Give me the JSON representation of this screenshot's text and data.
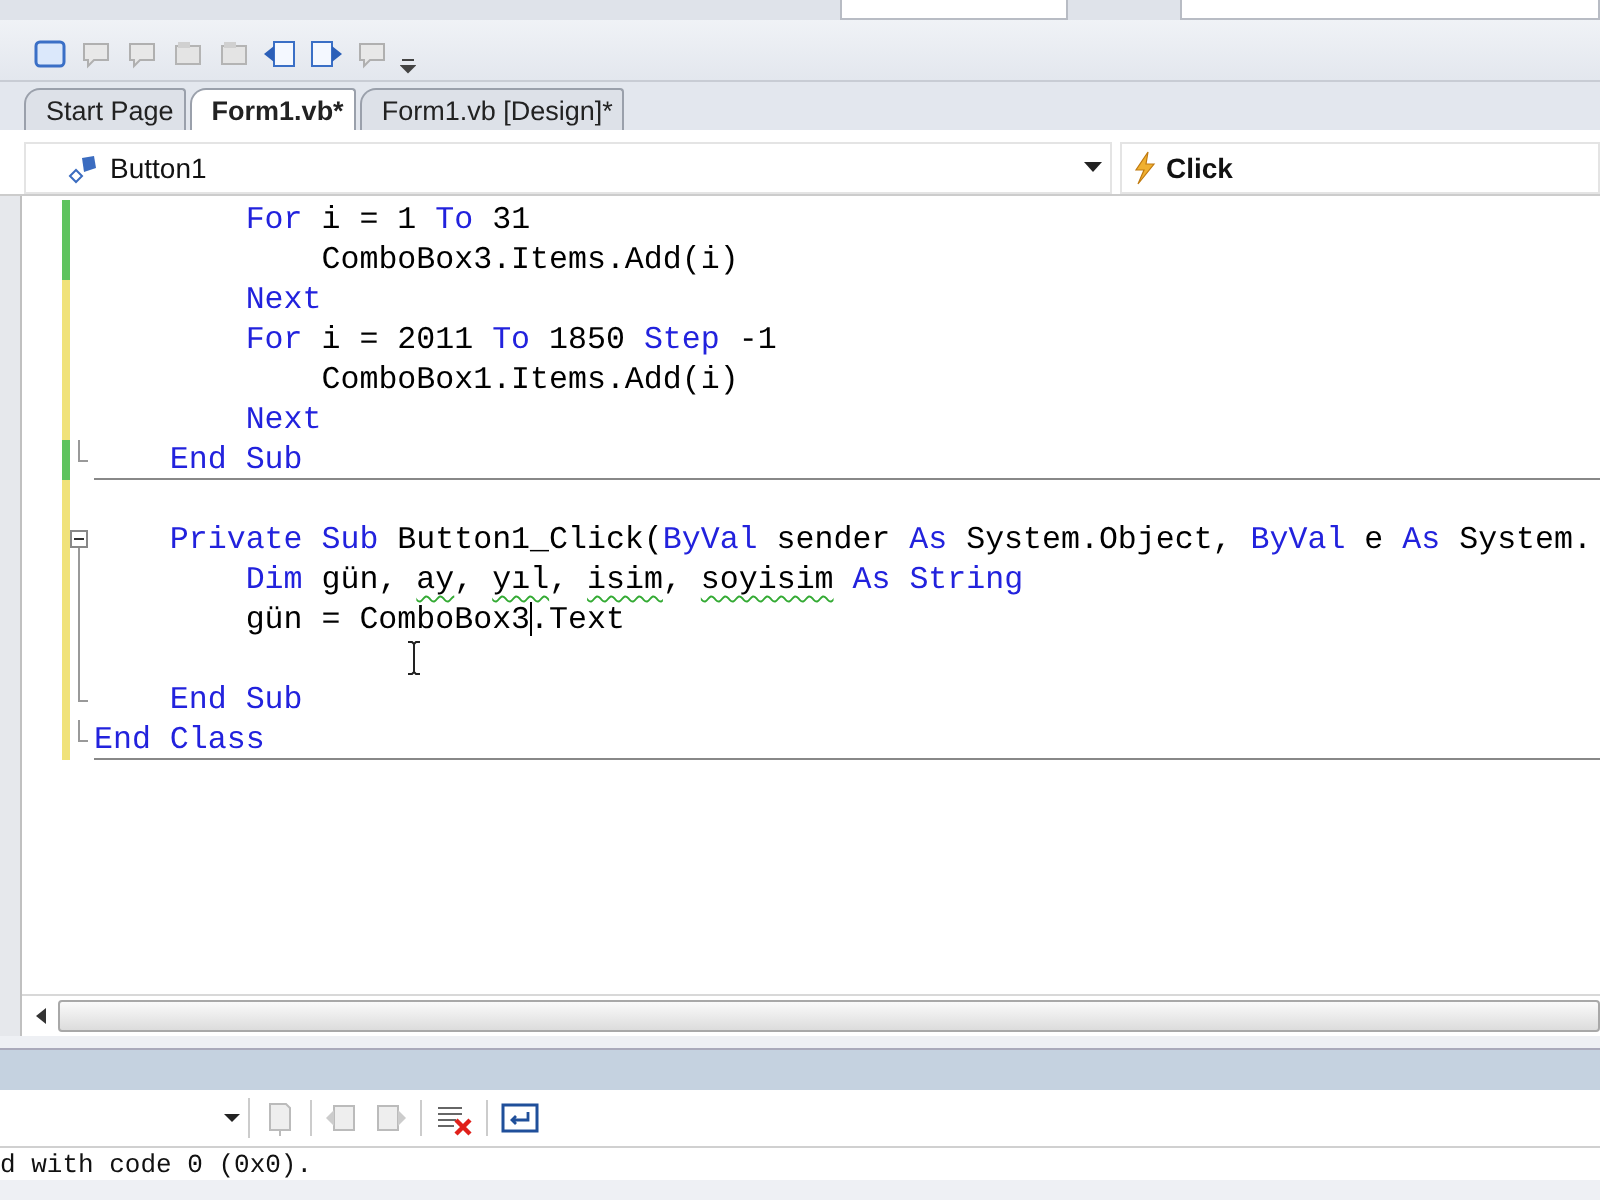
{
  "toolbar": {
    "buttons": [
      {
        "kind": "window"
      },
      {
        "kind": "comment"
      },
      {
        "kind": "comment"
      },
      {
        "kind": "bookmark"
      },
      {
        "kind": "bookmark"
      },
      {
        "kind": "prev"
      },
      {
        "kind": "next"
      },
      {
        "kind": "comment"
      }
    ]
  },
  "tabs": [
    {
      "label": "Start Page",
      "selected": false
    },
    {
      "label": "Form1.vb*",
      "selected": true
    },
    {
      "label": "Form1.vb [Design]*",
      "selected": false
    }
  ],
  "navigation": {
    "object": "Button1",
    "event": "Click"
  },
  "editor": {
    "lines": [
      {
        "saved": true,
        "kind": "statement",
        "tokens": [
          {
            "t": "For",
            "kind": "keyword"
          },
          {
            "t": " i = 1 "
          },
          {
            "t": "To",
            "kind": "keyword"
          },
          {
            "t": " 31"
          }
        ]
      },
      {
        "saved": true,
        "kind": "body",
        "tokens": [
          {
            "t": "ComboBox3.Items.Add(i)"
          }
        ]
      },
      {
        "saved": false,
        "kind": "statement",
        "tokens": [
          {
            "t": "Next",
            "kind": "keyword"
          }
        ]
      },
      {
        "saved": false,
        "kind": "statement",
        "tokens": [
          {
            "t": "For",
            "kind": "keyword"
          },
          {
            "t": " i = 2011 "
          },
          {
            "t": "To",
            "kind": "keyword"
          },
          {
            "t": " 1850 "
          },
          {
            "t": "Step",
            "kind": "keyword"
          },
          {
            "t": " -1"
          }
        ]
      },
      {
        "saved": false,
        "kind": "body",
        "tokens": [
          {
            "t": "ComboBox1.Items.Add(i)"
          }
        ]
      },
      {
        "saved": false,
        "kind": "statement",
        "tokens": [
          {
            "t": "Next",
            "kind": "keyword"
          }
        ]
      },
      {
        "saved": true,
        "kind": "member",
        "fold_end": true,
        "separator": true,
        "tokens": [
          {
            "t": "End Sub",
            "kind": "keyword"
          }
        ]
      },
      {
        "saved": false
      },
      {
        "saved": false,
        "kind": "member",
        "fold_start": true,
        "tokens": [
          {
            "t": "Private Sub",
            "kind": "keyword"
          },
          {
            "t": " Button1_Click("
          },
          {
            "t": "ByVal",
            "kind": "keyword"
          },
          {
            "t": " sender "
          },
          {
            "t": "As",
            "kind": "keyword"
          },
          {
            "t": " System.Object, "
          },
          {
            "t": "ByVal",
            "kind": "keyword"
          },
          {
            "t": " e "
          },
          {
            "t": "As",
            "kind": "keyword"
          },
          {
            "t": " System."
          }
        ]
      },
      {
        "saved": false,
        "kind": "statement",
        "in_fold": true,
        "tokens": [
          {
            "t": "Dim",
            "kind": "keyword"
          },
          {
            "t": " gün, "
          },
          {
            "t": "ay",
            "kind": "warning"
          },
          {
            "t": ", "
          },
          {
            "t": "yıl",
            "kind": "warning"
          },
          {
            "t": ", "
          },
          {
            "t": "isim",
            "kind": "warning"
          },
          {
            "t": ", "
          },
          {
            "t": "soyisim",
            "kind": "warning"
          },
          {
            "t": " As String",
            "kind": "keyword"
          }
        ]
      },
      {
        "saved": false,
        "kind": "statement",
        "in_fold": true,
        "tokens": [
          {
            "t": "gün = ComboBox3"
          },
          {
            "t": ".Text",
            "caret_before": true
          }
        ]
      },
      {
        "saved": false,
        "in_fold": true
      },
      {
        "saved": false,
        "kind": "member",
        "fold_end": true,
        "tokens": [
          {
            "t": "End Sub",
            "kind": "keyword"
          }
        ]
      },
      {
        "saved": false,
        "kind": "type",
        "fold_end": true,
        "separator": true,
        "tokens": [
          {
            "t": "End Class",
            "kind": "keyword"
          }
        ]
      }
    ]
  },
  "output": {
    "text": "d with code 0 (0x0)."
  }
}
